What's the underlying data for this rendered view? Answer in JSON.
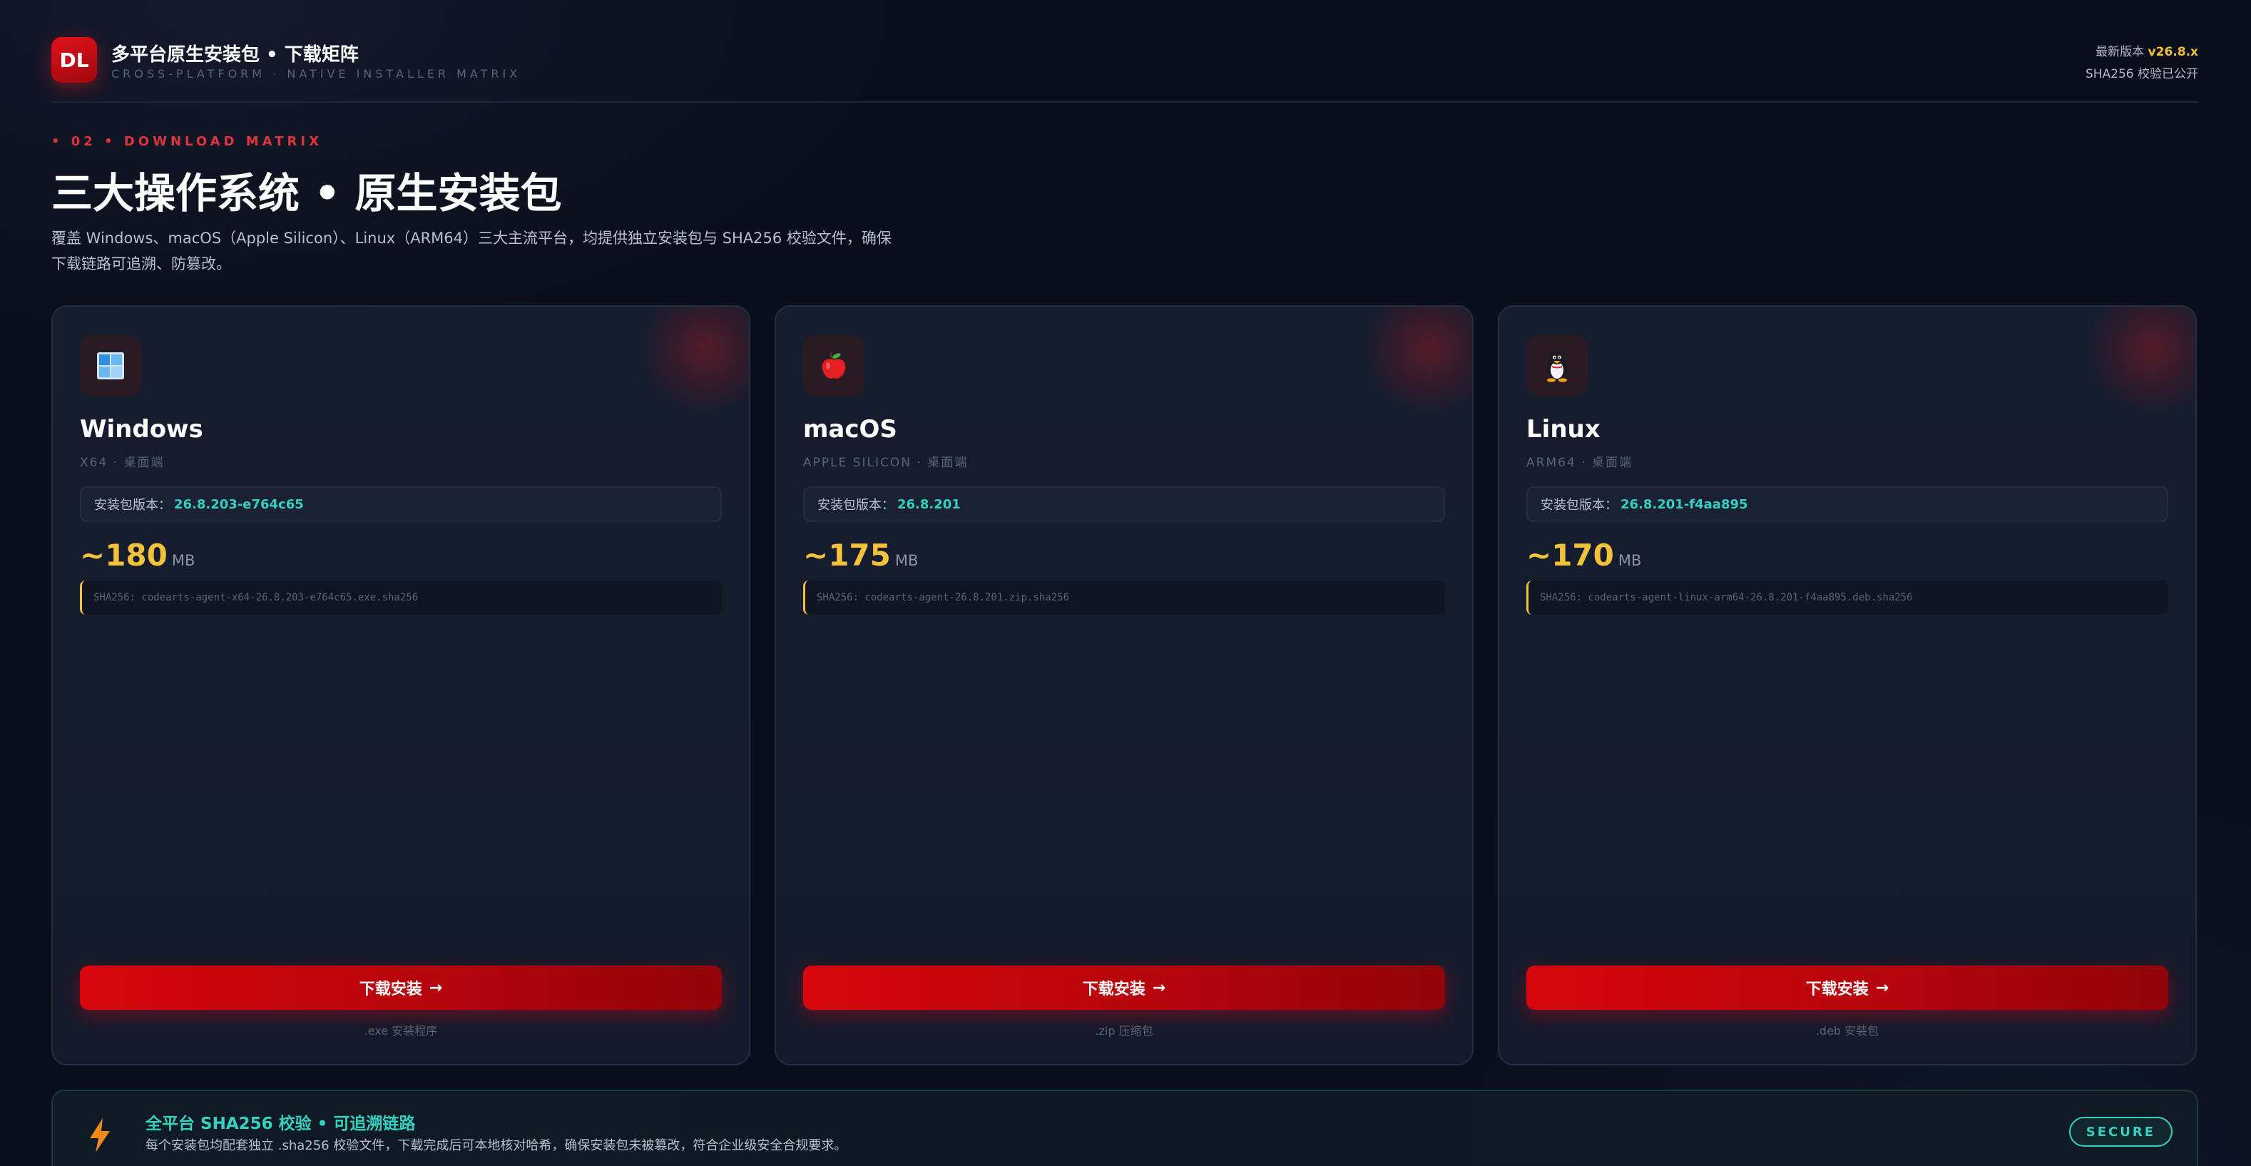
{
  "header": {
    "logo_text": "DL",
    "title": "多平台原生安装包 • 下载矩阵",
    "subtitle": "CROSS-PLATFORM · NATIVE INSTALLER MATRIX",
    "latest_label": "最新版本",
    "latest_version": "v26.8.x",
    "sha_status": "SHA256 校验已公开"
  },
  "section": {
    "tag": "• 02 • DOWNLOAD MATRIX",
    "title": "三大操作系统 • 原生安装包",
    "description": "覆盖 Windows、macOS（Apple Silicon）、Linux（ARM64）三大主流平台，均提供独立安装包与 SHA256 校验文件，确保下载链路可追溯、防篡改。"
  },
  "cards": [
    {
      "icon": "windows-icon",
      "name": "Windows",
      "arch": "X64 · 桌面端",
      "version_label": "安装包版本：",
      "version": "26.8.203-e764c65",
      "size_prefix": "~",
      "size": "180",
      "size_unit": "MB",
      "sha": "SHA256: codearts-agent-x64-26.8.203-e764c65.exe.sha256",
      "button_label": "下载安装",
      "button_arrow": "→",
      "package_type": ".exe 安装程序"
    },
    {
      "icon": "apple-icon",
      "name": "macOS",
      "arch": "APPLE SILICON · 桌面端",
      "version_label": "安装包版本：",
      "version": "26.8.201",
      "size_prefix": "~",
      "size": "175",
      "size_unit": "MB",
      "sha": "SHA256: codearts-agent-26.8.201.zip.sha256",
      "button_label": "下载安装",
      "button_arrow": "→",
      "package_type": ".zip 压缩包"
    },
    {
      "icon": "penguin-icon",
      "name": "Linux",
      "arch": "ARM64 · 桌面端",
      "version_label": "安装包版本：",
      "version": "26.8.201-f4aa895",
      "size_prefix": "~",
      "size": "170",
      "size_unit": "MB",
      "sha": "SHA256: codearts-agent-linux-arm64-26.8.201-f4aa895.deb.sha256",
      "button_label": "下载安装",
      "button_arrow": "→",
      "package_type": ".deb 安装包"
    }
  ],
  "banner": {
    "icon": "lightning-icon",
    "title": "全平台 SHA256 校验 • 可追溯链路",
    "description": "每个安装包均配套独立 .sha256 校验文件，下载完成后可本地核对哈希，确保安装包未被篡改，符合企业级安全合规要求。",
    "badge": "SECURE"
  },
  "colors": {
    "background": "#0a0e1a",
    "accent_red": "#d8060e",
    "accent_teal": "#34d0c0",
    "accent_gold": "#f2c23a"
  }
}
